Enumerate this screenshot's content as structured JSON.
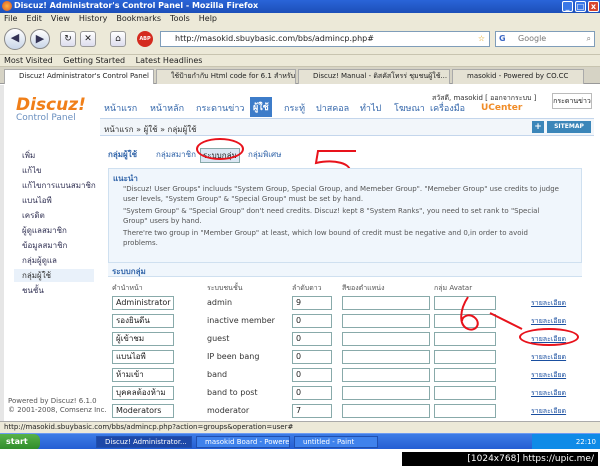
{
  "window": {
    "title": "Discuz! Administrator's Control Panel - Mozilla Firefox",
    "min": "_",
    "max": "□",
    "close": "x"
  },
  "menu": [
    "File",
    "Edit",
    "View",
    "History",
    "Bookmarks",
    "Tools",
    "Help"
  ],
  "nav": {
    "url": "http://masokid.sbuybasic.com/bbs/admincp.php#",
    "search_placeholder": "Google",
    "abp": "ABP"
  },
  "bookmarks": [
    "Most Visited",
    "Getting Started",
    "Latest Headlines"
  ],
  "tabs": [
    "Discuz! Administrator's Control Panel",
    "ใช้ป้ายกำกับ Html code for 6.1 สำหรับคนใ...",
    "Discuz! Manual - ดิสคัสโทรร่ ชุมชนผู้ใช้...",
    "masokid - Powered by CO.CC"
  ],
  "logo": {
    "name": "Discuz!",
    "sub": "Control Panel"
  },
  "topnav": [
    "หน้าแรก",
    "หน้าหลัก",
    "กระดานข่าว",
    "ผู้ใช้",
    "กระทู้",
    "ปาสคอล",
    "ทำไป",
    "โฆษณา",
    "เครื่องมือ"
  ],
  "user": {
    "line": "สวัสดี, masokid [ ออกจากระบบ ]",
    "ucenter": "UCenter",
    "search_label": "กระดานข่าว"
  },
  "breadcrumb": "หน้าแรก » ผู้ใช้ » กลุ่มผู้ใช้",
  "sitemap": "SITEMAP",
  "plus": "+",
  "sidebar": [
    "เพิ่ม",
    "แก้ไข",
    "แก้ไขการแบนสมาชิก",
    "แบนไอพี",
    "เครดิต",
    "ผู้ดูแลสมาชิก",
    "ข้อมูลสมาชิก",
    "กลุ่มผู้ดูแล",
    "กลุ่มผู้ใช้",
    "ชนชั้น"
  ],
  "powered": [
    "Powered by Discuz! 6.1.0",
    "© 2001-2008, Comsenz Inc."
  ],
  "subtabs": [
    "กลุ่มผู้ใช้",
    "กลุ่มสมาชิก",
    "ระบบกลุ่ม",
    "กลุ่มพิเศษ"
  ],
  "notice": {
    "heading": "แนะนำ",
    "lines": [
      "\"Discuz! User Groups\" incluuds \"System Group, Special Group, and Memeber Group\". \"Memeber Group\" use credits to judge",
      "user levels, \"System Group\" & \"Special Group\" must be set by hand.",
      "\"System Group\" & \"Special Group\" don't need credits. Discuz! kept 8 \"System Ranks\", you need to set rank to \"Special",
      "Group\" users by hand.",
      "There're two group in \"Member Group\" at least, which low bound of credit must be negative and 0,in order to avoid",
      "problems."
    ]
  },
  "section": "ระบบกลุ่ม",
  "columns": [
    "คำนำหน้า",
    "ระบบชนชั้น",
    "ลำดับดาว",
    "สีของตำแหน่ง",
    "กลุ่ม Avatar",
    ""
  ],
  "rows": [
    {
      "title": "Administrator",
      "name": "admin",
      "stars": "9",
      "link": "รายละเอียด"
    },
    {
      "title": "รองยินดีน",
      "name": "inactive member",
      "stars": "0",
      "link": "รายละเอียด"
    },
    {
      "title": "ผู้เข้าชม",
      "name": "guest",
      "stars": "0",
      "link": "รายละเอียด"
    },
    {
      "title": "แบนไอพี",
      "name": "IP been bang",
      "stars": "0",
      "link": "รายละเอียด"
    },
    {
      "title": "ห้ามเข้า",
      "name": "band",
      "stars": "0",
      "link": "รายละเอียด"
    },
    {
      "title": "บุคคลต้องห้าม",
      "name": "band to post",
      "stars": "0",
      "link": "รายละเอียด"
    },
    {
      "title": "Moderators",
      "name": "moderator",
      "stars": "7",
      "link": "รายละเอียด"
    }
  ],
  "annotations": {
    "five": "5",
    "six": "6"
  },
  "status": "http://masokid.sbuybasic.com/bbs/admincp.php?action=groups&operation=user#",
  "taskbar": {
    "start": "start",
    "items": [
      "Discuz! Administrator...",
      "masokid Board - Powere...",
      "untitled - Paint"
    ],
    "clock": "22:10"
  },
  "watermark": "[1024x768] https://upic.me/"
}
